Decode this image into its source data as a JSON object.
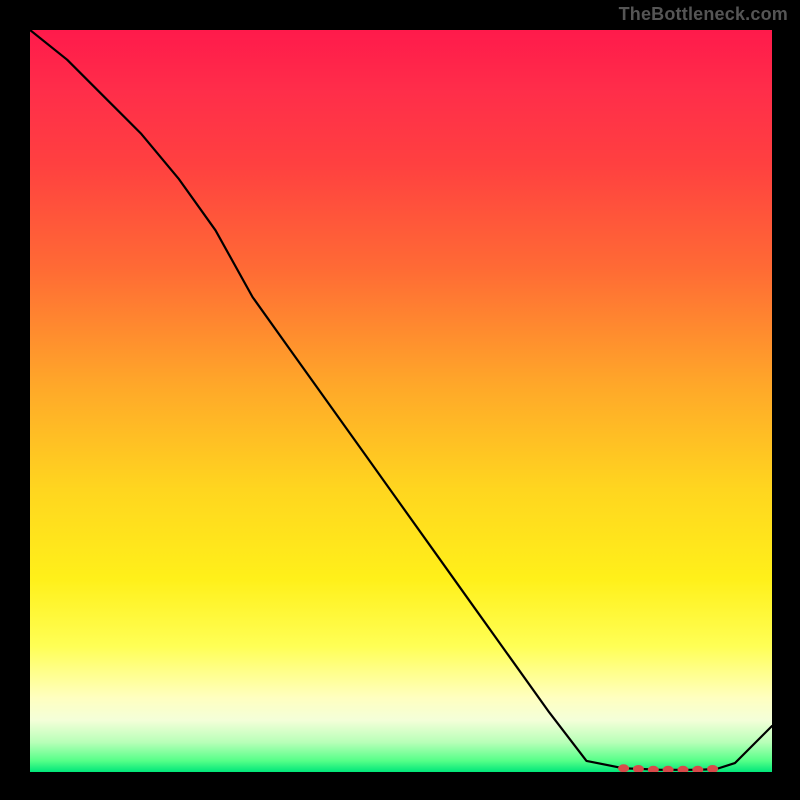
{
  "watermark": "TheBottleneck.com",
  "chart_data": {
    "type": "line",
    "title": "",
    "xlabel": "",
    "ylabel": "",
    "x": [
      0.0,
      0.05,
      0.1,
      0.15,
      0.2,
      0.25,
      0.3,
      0.35,
      0.4,
      0.45,
      0.5,
      0.55,
      0.6,
      0.65,
      0.7,
      0.75,
      0.8,
      0.825,
      0.85,
      0.875,
      0.9,
      0.925,
      0.95,
      1.0
    ],
    "values": [
      1.0,
      0.96,
      0.91,
      0.86,
      0.8,
      0.73,
      0.64,
      0.57,
      0.5,
      0.43,
      0.36,
      0.29,
      0.22,
      0.15,
      0.08,
      0.015,
      0.005,
      0.004,
      0.003,
      0.003,
      0.003,
      0.004,
      0.012,
      0.062
    ],
    "xlim": [
      0,
      1
    ],
    "ylim": [
      0,
      1
    ],
    "markers": {
      "x": [
        0.8,
        0.82,
        0.84,
        0.86,
        0.88,
        0.9,
        0.92
      ],
      "y": [
        0.005,
        0.004,
        0.003,
        0.003,
        0.003,
        0.003,
        0.004
      ],
      "color": "#d84a4a"
    },
    "gradient_stops": [
      {
        "pos": 0.0,
        "color": "#ff1a4b"
      },
      {
        "pos": 0.3,
        "color": "#ff6a35"
      },
      {
        "pos": 0.6,
        "color": "#ffd61f"
      },
      {
        "pos": 0.85,
        "color": "#ffff88"
      },
      {
        "pos": 1.0,
        "color": "#00e67a"
      }
    ]
  }
}
